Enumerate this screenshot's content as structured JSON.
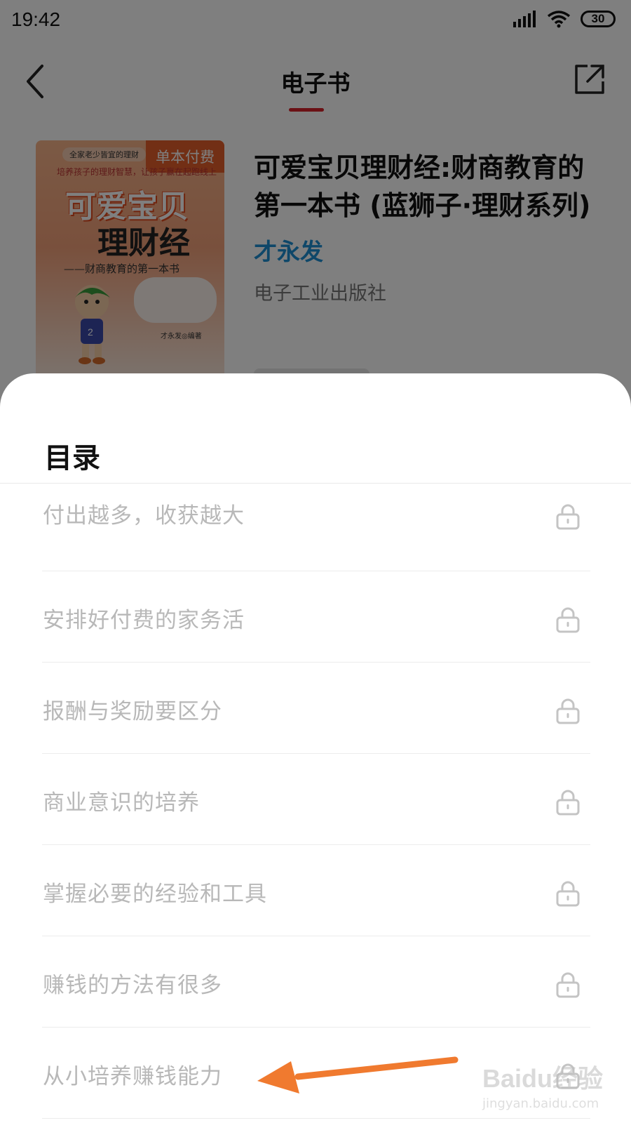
{
  "status_bar": {
    "time": "19:42",
    "battery": "30"
  },
  "header": {
    "title": "电子书"
  },
  "book": {
    "cover_badge": "单本付费",
    "cover_top_line": "全家老少皆宜的理财",
    "cover_subline": "培养孩子的理财智慧，让孩子赢在起跑线上",
    "cover_title_1": "可爱宝贝",
    "cover_title_2": "理财经",
    "cover_subtitle": "——财商教育的第一本书",
    "cover_author": "才永发◎编著",
    "title": "可爱宝贝理财经:财商教育的第一本书 (蓝狮子·理财系列)",
    "author": "才永发",
    "publisher": "电子工业出版社"
  },
  "toc": {
    "title": "目录",
    "items": [
      {
        "label": "付出越多，收获越大",
        "locked": true
      },
      {
        "label": "安排好付费的家务活",
        "locked": true
      },
      {
        "label": "报酬与奖励要区分",
        "locked": true
      },
      {
        "label": "商业意识的培养",
        "locked": true
      },
      {
        "label": "掌握必要的经验和工具",
        "locked": true
      },
      {
        "label": "赚钱的方法有很多",
        "locked": true
      },
      {
        "label": "从小培养赚钱能力",
        "locked": true
      }
    ]
  },
  "watermark": {
    "main": "Baidu经验",
    "url": "jingyan.baidu.com"
  },
  "colors": {
    "accent_red": "#d6232b",
    "author_blue": "#1d8ed3",
    "annotation_arrow": "#f07a2f"
  },
  "icons": {
    "back": "chevron-left-icon",
    "share": "share-icon",
    "lock": "lock-icon"
  }
}
